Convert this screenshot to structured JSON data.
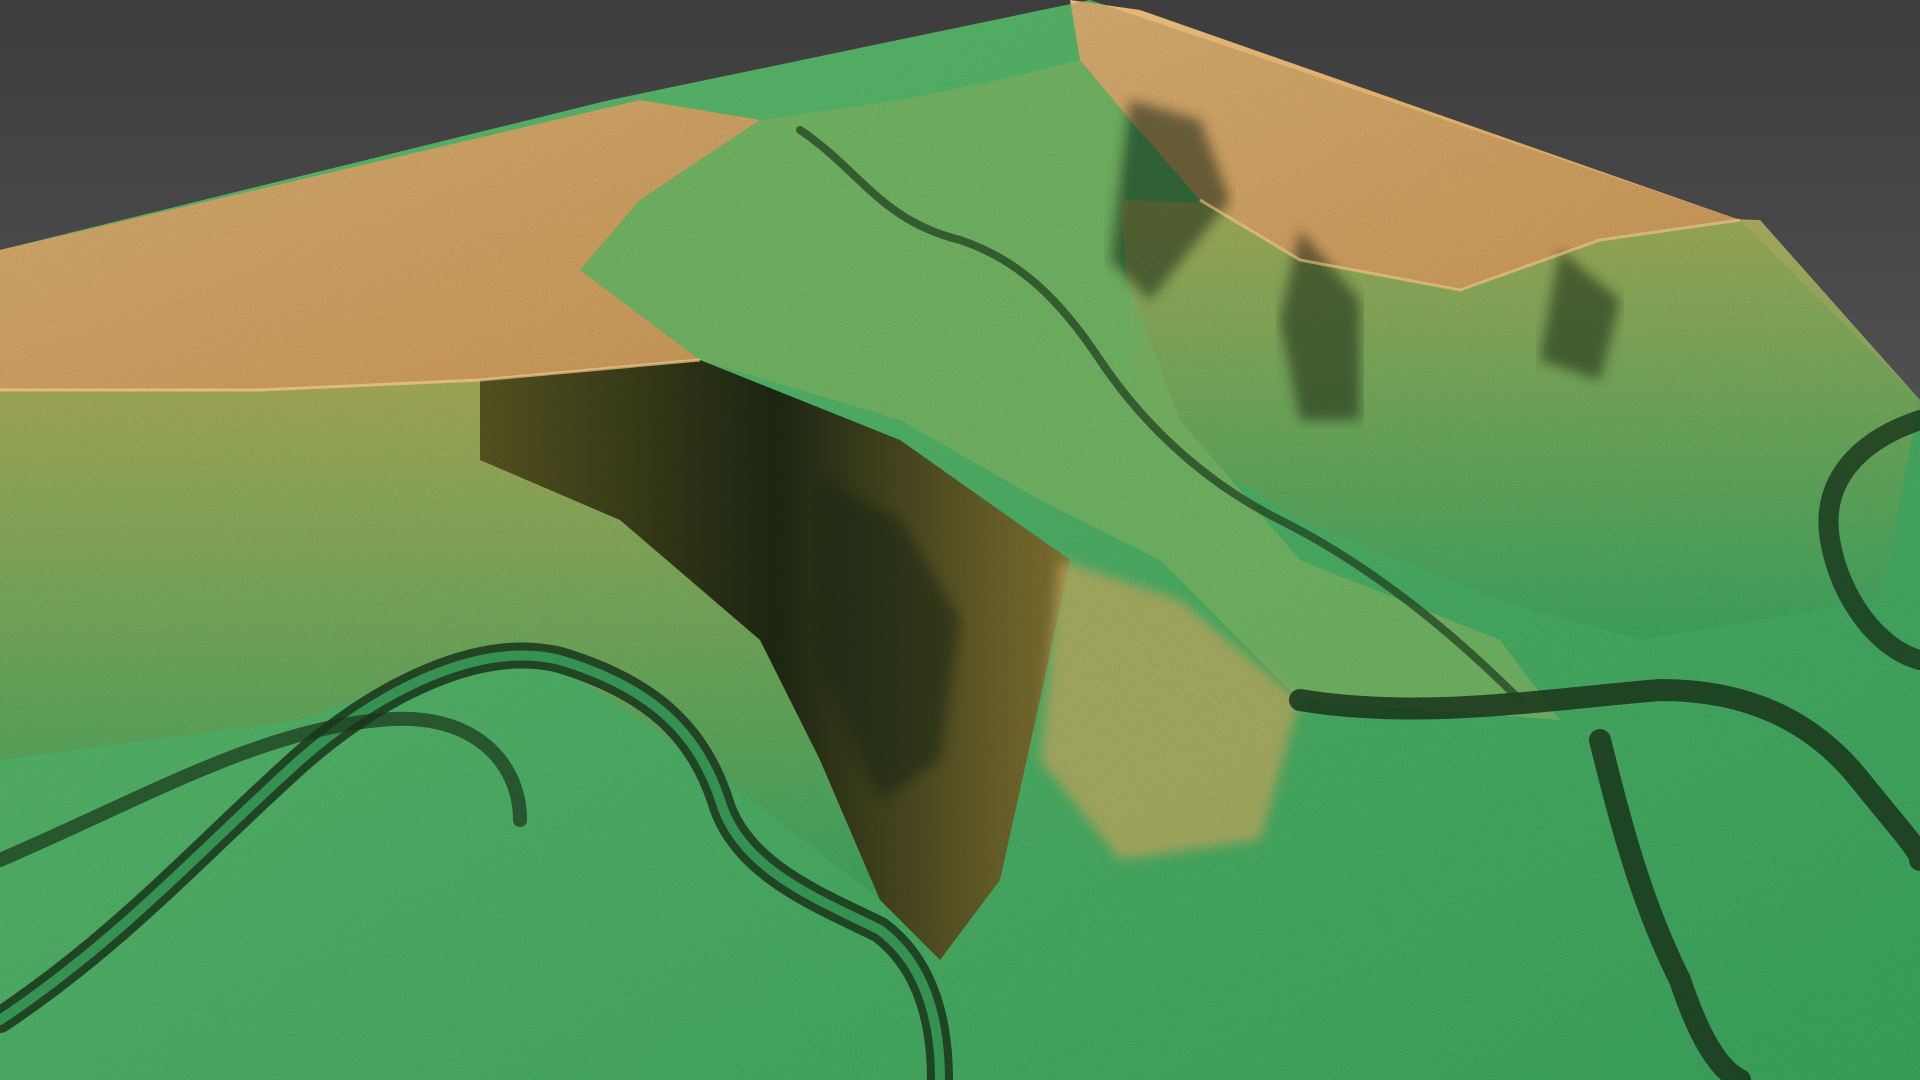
{
  "scene": {
    "kind": "3d-relief-terrain-render",
    "colors": {
      "background_top": "#3d3d3d",
      "background_bottom": "#6e6e6e",
      "highland": "#d9a35e",
      "highland_light": "#e3b878",
      "slope_mid": "#b9b45c",
      "lowland": "#3fae63",
      "lowland_light": "#66c774",
      "shadow": "#1f2a14",
      "river_channel": "#1c3b1e"
    },
    "features": [
      {
        "name": "western-plateau",
        "type": "plateau"
      },
      {
        "name": "eastern-plateau",
        "type": "plateau"
      },
      {
        "name": "central-valley",
        "type": "valley"
      },
      {
        "name": "meandering-river-south",
        "type": "river"
      },
      {
        "name": "meandering-river-east",
        "type": "river"
      },
      {
        "name": "steep-escarpment",
        "type": "cliff"
      }
    ]
  }
}
